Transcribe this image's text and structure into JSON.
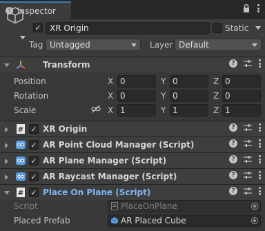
{
  "window": {
    "tab_title": "Inspector"
  },
  "header": {
    "object_name": "XR Origin",
    "static_label": "Static",
    "tag_label": "Tag",
    "tag_value": "Untagged",
    "layer_label": "Layer",
    "layer_value": "Default"
  },
  "transform": {
    "title": "Transform",
    "rows": [
      {
        "label": "Position",
        "x": "0",
        "y": "0",
        "z": "0"
      },
      {
        "label": "Rotation",
        "x": "0",
        "y": "0",
        "z": "0"
      },
      {
        "label": "Scale",
        "x": "1",
        "y": "1",
        "z": "1"
      }
    ],
    "axes": [
      "X",
      "Y",
      "Z"
    ]
  },
  "components": [
    {
      "title": "XR Origin",
      "icon": "script-icon"
    },
    {
      "title": "AR Point Cloud Manager (Script)",
      "icon": "ar-component-icon"
    },
    {
      "title": "AR Plane Manager (Script)",
      "icon": "ar-component-icon"
    },
    {
      "title": "AR Raycast Manager (Script)",
      "icon": "ar-component-icon"
    },
    {
      "title": "Place On Plane (Script)",
      "icon": "script-icon"
    }
  ],
  "place_on_plane": {
    "script_label": "Script",
    "script_value": "PlaceOnPlane",
    "prefab_label": "Placed Prefab",
    "prefab_value": "AR Placed Cube"
  },
  "colors": {
    "background": "#383838",
    "accent": "#3a79bb",
    "link": "#7eb6f6"
  }
}
